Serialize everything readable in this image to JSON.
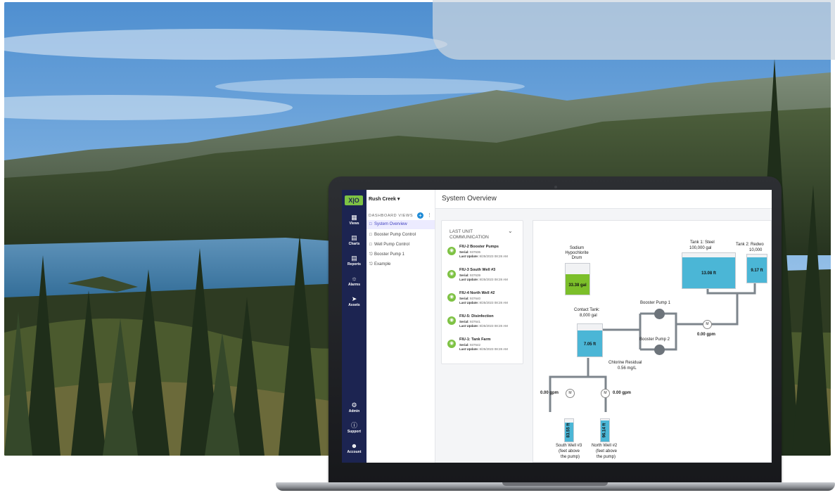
{
  "app": {
    "site": "Rush Creek",
    "page_title": "System Overview"
  },
  "nav": [
    {
      "label": "Views",
      "icon": "views-icon"
    },
    {
      "label": "Charts",
      "icon": "charts-icon"
    },
    {
      "label": "Reports",
      "icon": "reports-icon"
    },
    {
      "label": "Alarms",
      "icon": "alarms-icon"
    },
    {
      "label": "Assets",
      "icon": "assets-icon"
    },
    {
      "label": "Admin",
      "icon": "admin-icon"
    },
    {
      "label": "Support",
      "icon": "support-icon"
    },
    {
      "label": "Account",
      "icon": "account-icon"
    }
  ],
  "sidebar": {
    "section_title": "DASHBOARD VIEWS",
    "items": [
      {
        "label": "System Overview",
        "active": true
      },
      {
        "label": "Booster Pump Control"
      },
      {
        "label": "Well Pump Control"
      },
      {
        "label": "Booster Pump 1"
      },
      {
        "label": "Example"
      }
    ]
  },
  "communication": {
    "title": "LAST UNIT COMMUNICATION",
    "serial_label": "Serial:",
    "update_label": "Last Update:",
    "units": [
      {
        "name": "FIU-2 Booster Pumps",
        "serial": "937636",
        "update": "8/25/2023 08:28 AM"
      },
      {
        "name": "FIU-3 South Well #3",
        "serial": "937639",
        "update": "8/25/2023 08:28 AM"
      },
      {
        "name": "FIU-4 North Well #2",
        "serial": "937640",
        "update": "8/25/2023 08:28 AM"
      },
      {
        "name": "FIU-5: Disinfection",
        "serial": "937641",
        "update": "8/25/2023 08:28 AM"
      },
      {
        "name": "FIU-1: Tank Farm",
        "serial": "937642",
        "update": "8/25/2023 08:28 AM"
      }
    ]
  },
  "diagram": {
    "drum": {
      "label": "Sodium Hypochlorite Drum",
      "value": "33.38 gal",
      "level": 0.62
    },
    "tank_steel": {
      "label": "Tank 1: Steel",
      "capacity": "100,000 gal",
      "value": "13.08 ft",
      "level": 0.85
    },
    "tank_redwood": {
      "label": "Tank 2: Redwo",
      "capacity": "10,000",
      "value": "9.17 ft",
      "level": 0.85
    },
    "contact_tank": {
      "label": "Contact Tank:",
      "capacity": "8,000 gal",
      "value": "7.05 ft",
      "level": 0.78
    },
    "pump1": "Booster Pump 1",
    "pump2": "Booster Pump 2",
    "meter_main": "0.00 gpm",
    "chlorine": {
      "label": "Chlorine Residual",
      "value": "0.56 mg/L"
    },
    "meter_south": "0.00 gpm",
    "meter_north": "0.00 gpm",
    "meter_symbol": "M",
    "south_well": {
      "label": "South Well #3",
      "sub1": "(feet above",
      "sub2": "the pump)",
      "value": "83.55 ft",
      "level": 0.8
    },
    "north_well": {
      "label": "North Well #2",
      "sub1": "(feet above",
      "sub2": "the pump)",
      "value": "96.14 ft",
      "level": 0.88
    }
  },
  "colors": {
    "rail": "#1c2451",
    "accent": "#7ec244",
    "water": "#4bb6d6",
    "chem": "#7cbf2a"
  }
}
